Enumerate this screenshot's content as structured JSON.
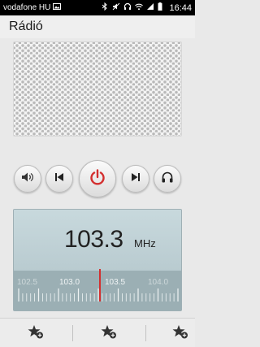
{
  "status_bar": {
    "carrier": "vodafone HU",
    "time": "16:44",
    "icons": [
      "image-icon",
      "bluetooth-icon",
      "mute-icon",
      "headset-icon",
      "wifi-icon",
      "signal-icon",
      "battery-icon"
    ]
  },
  "app": {
    "title": "Rádió"
  },
  "controls": {
    "volume": "volume-icon",
    "previous": "skip-previous-icon",
    "power": "power-icon",
    "next": "skip-next-icon",
    "headset": "headset-icon"
  },
  "tuner": {
    "frequency": "103.3",
    "unit": "MHz",
    "scale_labels": [
      "102.5",
      "103.0",
      "103.5",
      "104.0"
    ]
  },
  "favorites": {
    "slots": [
      "add-favorite-icon",
      "add-favorite-icon",
      "add-favorite-icon"
    ]
  },
  "colors": {
    "accent": "#d32f2f",
    "tuner_background": "#bdd0d5",
    "scale_background": "#9bafb4"
  }
}
